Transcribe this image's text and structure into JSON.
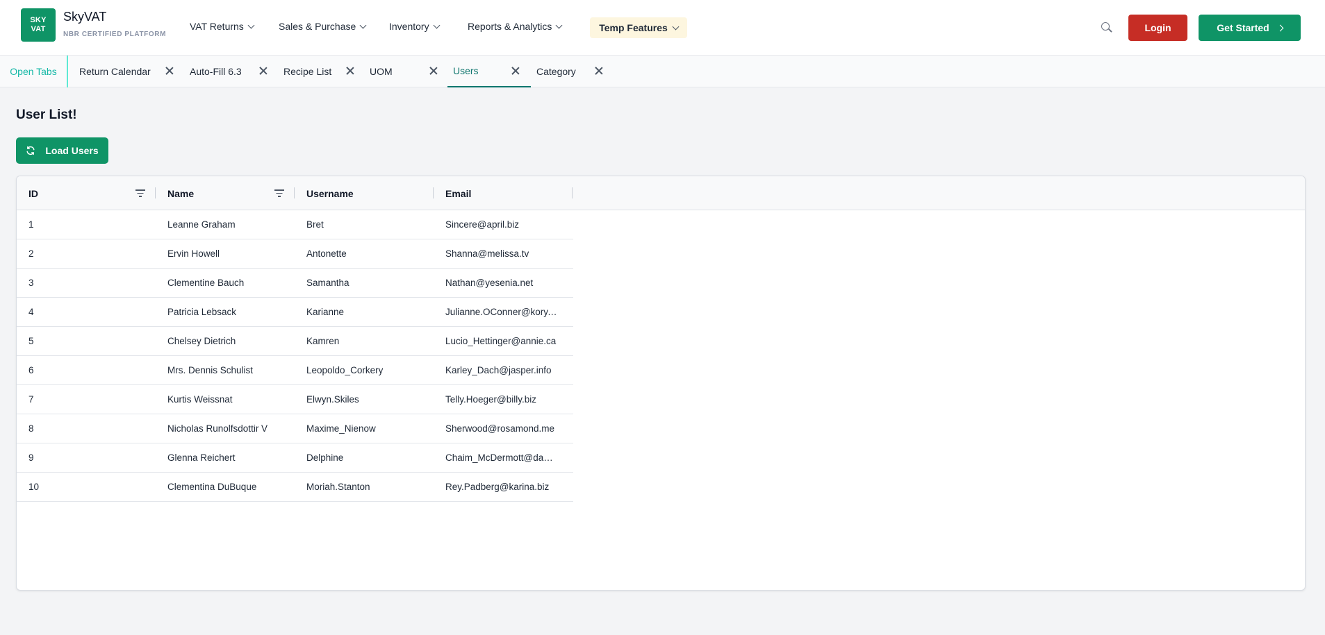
{
  "brand": {
    "logo_line1": "SKY",
    "logo_line2": "VAT",
    "name": "SkyVAT",
    "subtitle": "NBR CERTIFIED PLATFORM",
    "accent": "#0f9466"
  },
  "nav": {
    "items": [
      {
        "label": "VAT Returns"
      },
      {
        "label": "Sales & Purchase"
      },
      {
        "label": "Inventory"
      },
      {
        "label": "Reports & Analytics"
      }
    ],
    "temp_features": "Temp Features",
    "search_icon": "search-icon",
    "login_label": "Login",
    "get_started_label": "Get Started"
  },
  "tabs": {
    "open_tabs_label": "Open Tabs",
    "items": [
      {
        "label": "Return Calendar",
        "active": false
      },
      {
        "label": "Auto-Fill 6.3",
        "active": false
      },
      {
        "label": "Recipe List",
        "active": false
      },
      {
        "label": "UOM",
        "active": false
      },
      {
        "label": "Users",
        "active": true
      },
      {
        "label": "Category",
        "active": false
      }
    ]
  },
  "main": {
    "title": "User List!",
    "load_button": "Load Users",
    "table": {
      "columns": [
        "ID",
        "Name",
        "Username",
        "Email"
      ],
      "rows": [
        {
          "id": "1",
          "name": "Leanne Graham",
          "username": "Bret",
          "email": "Sincere@april.biz"
        },
        {
          "id": "2",
          "name": "Ervin Howell",
          "username": "Antonette",
          "email": "Shanna@melissa.tv"
        },
        {
          "id": "3",
          "name": "Clementine Bauch",
          "username": "Samantha",
          "email": "Nathan@yesenia.net"
        },
        {
          "id": "4",
          "name": "Patricia Lebsack",
          "username": "Karianne",
          "email": "Julianne.OConner@kory.org"
        },
        {
          "id": "5",
          "name": "Chelsey Dietrich",
          "username": "Kamren",
          "email": "Lucio_Hettinger@annie.ca"
        },
        {
          "id": "6",
          "name": "Mrs. Dennis Schulist",
          "username": "Leopoldo_Corkery",
          "email": "Karley_Dach@jasper.info"
        },
        {
          "id": "7",
          "name": "Kurtis Weissnat",
          "username": "Elwyn.Skiles",
          "email": "Telly.Hoeger@billy.biz"
        },
        {
          "id": "8",
          "name": "Nicholas Runolfsdottir V",
          "username": "Maxime_Nienow",
          "email": "Sherwood@rosamond.me"
        },
        {
          "id": "9",
          "name": "Glenna Reichert",
          "username": "Delphine",
          "email": "Chaim_McDermott@dana.io"
        },
        {
          "id": "10",
          "name": "Clementina DuBuque",
          "username": "Moriah.Stanton",
          "email": "Rey.Padberg@karina.biz"
        }
      ]
    }
  }
}
